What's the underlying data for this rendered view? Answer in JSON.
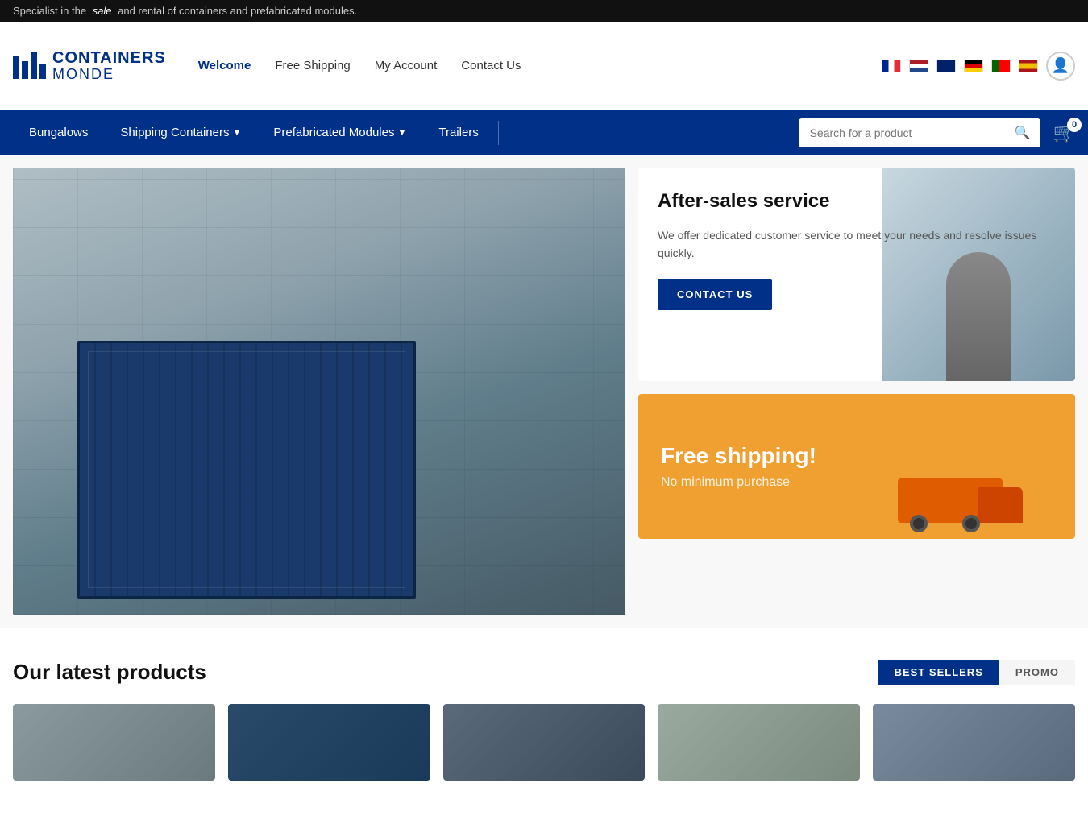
{
  "topBanner": {
    "text_before": "Specialist in the",
    "italic": "sale",
    "text_after": "and rental of containers and prefabricated modules."
  },
  "header": {
    "logo": {
      "brand": "CONTAINERS",
      "sub": "MONDE"
    },
    "nav": [
      {
        "label": "Welcome",
        "active": true
      },
      {
        "label": "Free Shipping",
        "active": false
      },
      {
        "label": "My Account",
        "active": false
      },
      {
        "label": "Contact Us",
        "active": false
      }
    ],
    "languages": [
      "FR",
      "NL",
      "EN",
      "DE",
      "PT",
      "ES"
    ],
    "cart": {
      "count": "0"
    }
  },
  "navbar": {
    "items": [
      {
        "label": "Bungalows",
        "hasDropdown": false
      },
      {
        "label": "Shipping Containers",
        "hasDropdown": true
      },
      {
        "label": "Prefabricated Modules",
        "hasDropdown": true
      },
      {
        "label": "Trailers",
        "hasDropdown": false
      }
    ]
  },
  "search": {
    "placeholder": "Search for a product"
  },
  "afterSales": {
    "title": "After-sales service",
    "description": "We offer dedicated customer service to meet your needs and resolve issues quickly.",
    "button": "CONTACT US"
  },
  "freeShipping": {
    "title": "Free shipping!",
    "subtitle": "No minimum purchase"
  },
  "latestProducts": {
    "title": "Our latest products",
    "tabs": [
      {
        "label": "BEST SELLERS",
        "active": true
      },
      {
        "label": "PROMO",
        "active": false
      }
    ]
  }
}
